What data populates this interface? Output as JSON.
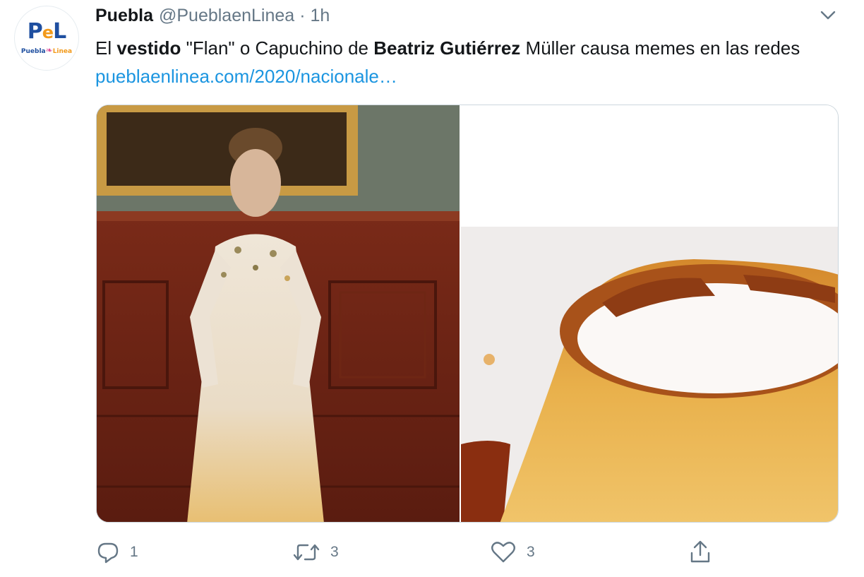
{
  "account": {
    "display_name": "Puebla",
    "handle": "@PueblaenLinea",
    "separator": "·",
    "time": "1h",
    "avatar_logo": "PeL",
    "avatar_subtitle": "PueblaLinea"
  },
  "tweet": {
    "text_parts": {
      "p1": "El ",
      "b1": "vestido",
      "p2": " \"Flan\" o Capuchino de ",
      "b2": "Beatriz Gutiérrez",
      "p3": " Müller causa memes en las redes ",
      "link": "pueblaenlinea.com/2020/nacionale…"
    }
  },
  "media": {
    "left_image": "woman-in-cream-dress-photo",
    "right_image": "flan-dessert-photo"
  },
  "actions": {
    "reply_count": "1",
    "retweet_count": "3",
    "like_count": "3"
  },
  "icons": {
    "caret": "chevron-down-icon",
    "reply": "reply-icon",
    "retweet": "retweet-icon",
    "like": "heart-icon",
    "share": "share-icon"
  },
  "colors": {
    "link": "#1b95e0",
    "secondary_text": "#657786",
    "primary_text": "#14171a",
    "brand_blue": "#1f4fa0",
    "brand_orange": "#f29a1b"
  }
}
